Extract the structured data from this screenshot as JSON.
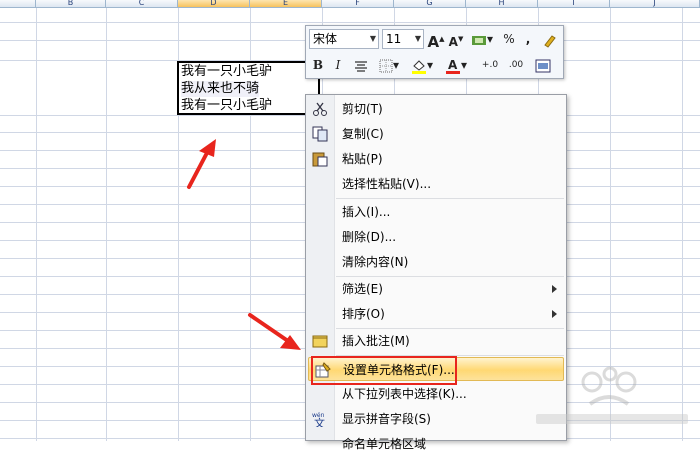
{
  "columns": [
    "B",
    "C",
    "D",
    "E",
    "F",
    "G",
    "H",
    "I",
    "J"
  ],
  "selected_cells": {
    "lines": [
      "我有一只小毛驴",
      "我从来也不骑",
      "我有一只小毛驴"
    ]
  },
  "mini_toolbar": {
    "font_name": "宋体",
    "font_size": "11",
    "bold": "B",
    "italic": "I",
    "percent": "%",
    "comma": ","
  },
  "context_menu": {
    "items": [
      {
        "label": "剪切(T)",
        "icon": "scissors-icon"
      },
      {
        "label": "复制(C)",
        "icon": "copy-icon"
      },
      {
        "label": "粘贴(P)",
        "icon": "paste-icon"
      },
      {
        "label": "选择性粘贴(V)..."
      },
      {
        "label": "插入(I)..."
      },
      {
        "label": "删除(D)..."
      },
      {
        "label": "清除内容(N)"
      },
      {
        "label": "筛选(E)",
        "submenu": true
      },
      {
        "label": "排序(O)",
        "submenu": true
      },
      {
        "label": "插入批注(M)",
        "icon": "comment-icon"
      },
      {
        "label": "设置单元格格式(F)...",
        "icon": "format-cells-icon"
      },
      {
        "label": "从下拉列表中选择(K)..."
      },
      {
        "label": "显示拼音字段(S)",
        "icon": "phonetic-icon"
      },
      {
        "label": "命名单元格区域"
      }
    ]
  },
  "colors": {
    "highlight": "#ffd873",
    "red_annotation": "#e8251d",
    "grid": "#d0d7e5"
  }
}
